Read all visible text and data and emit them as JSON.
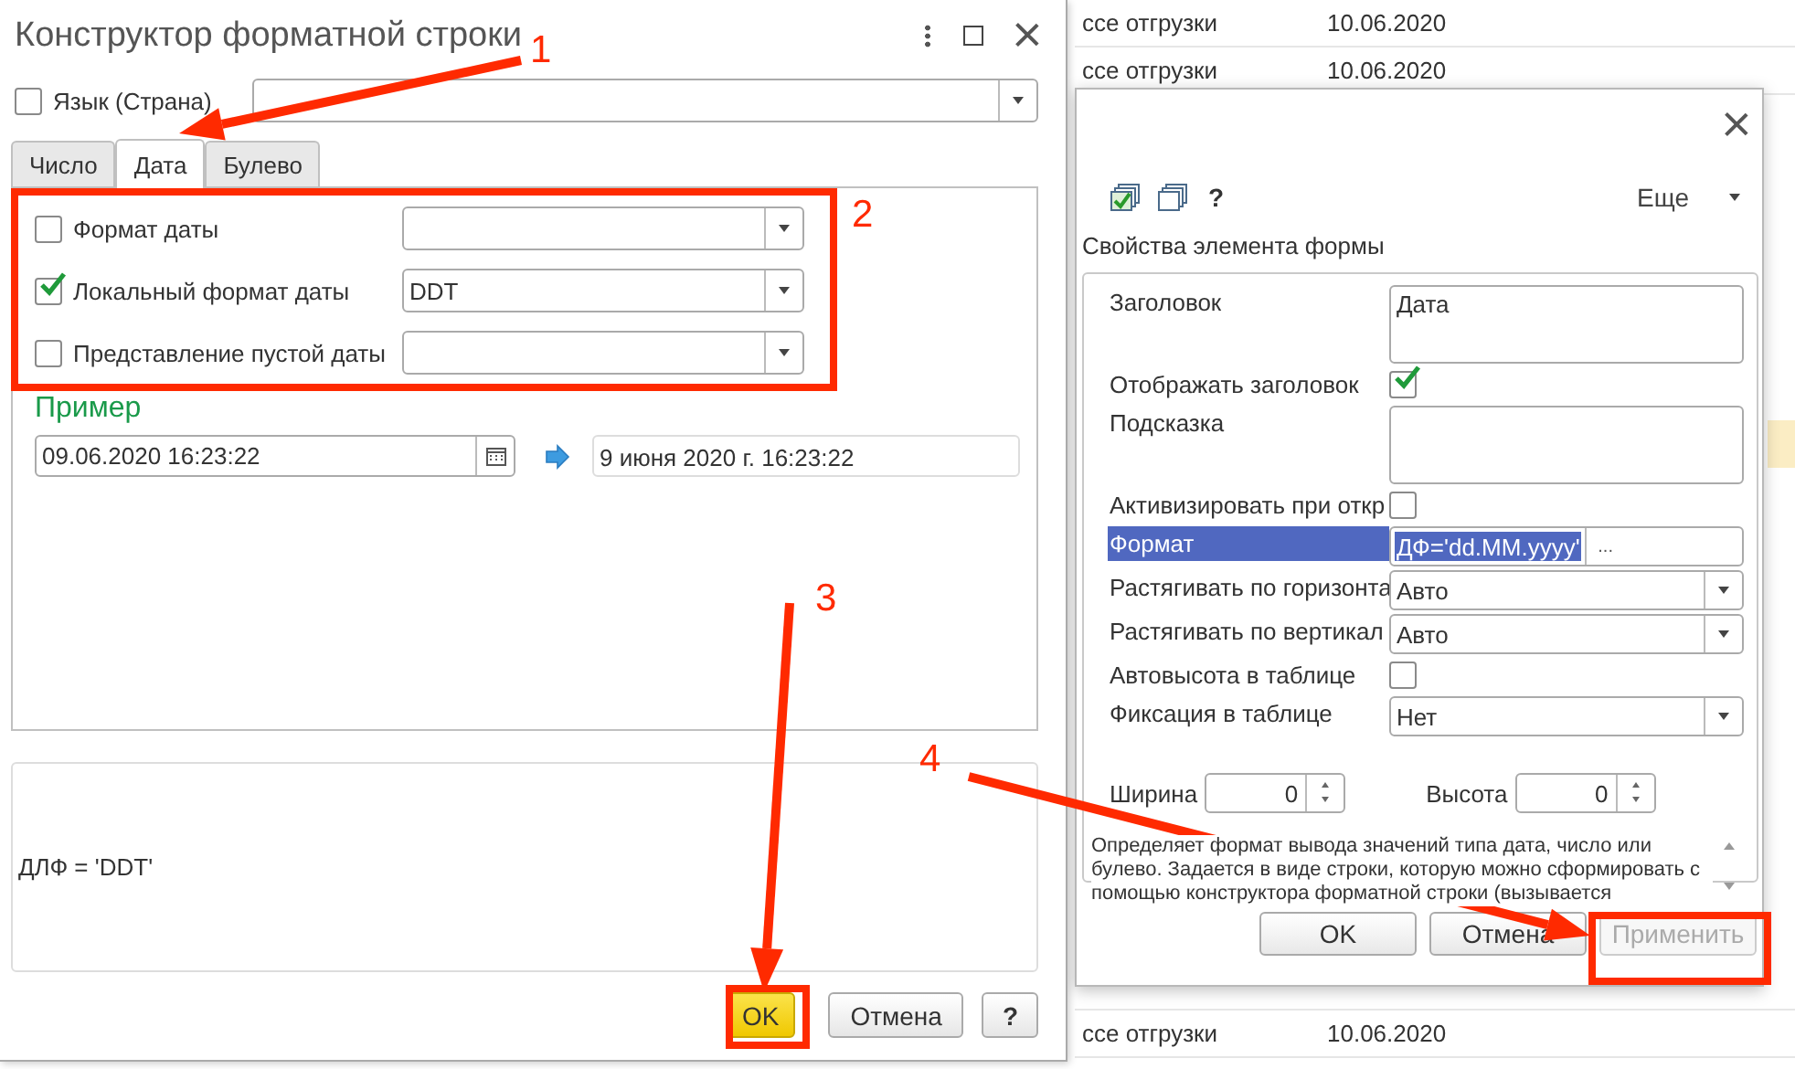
{
  "background_list": {
    "rows": [
      {
        "column_1": "ссе отгрузки",
        "column_2": "10.06.2020"
      },
      {
        "column_1": "ссе отгрузки",
        "column_2": "10.06.2020"
      },
      {
        "column_1": "ссе отгрузки",
        "column_2": "10.06.2020"
      }
    ]
  },
  "properties_window": {
    "more_label": "Еще",
    "help_label": "?",
    "section_title": "Свойства элемента формы",
    "properties": [
      {
        "kind": "textarea",
        "label": "Заголовок",
        "value": "Дата",
        "selected": false
      },
      {
        "kind": "checkbox",
        "label": "Отображать заголовок",
        "checked": true,
        "selected": false
      },
      {
        "kind": "textarea",
        "label": "Подсказка",
        "selected": false
      },
      {
        "kind": "checkbox",
        "label": "Активизировать при откр",
        "checked": false,
        "selected": false
      },
      {
        "kind": "picker",
        "label": "Формат",
        "value": "ДФ='dd.MM.yyyy'",
        "button_label": "...",
        "selected": true
      },
      {
        "kind": "dropdown",
        "label": "Растягивать по горизонта",
        "value": "Авто",
        "selected": false
      },
      {
        "kind": "dropdown",
        "label": "Растягивать по вертикал",
        "value": "Авто",
        "selected": false
      },
      {
        "kind": "checkbox",
        "label": "Автовысота в таблице",
        "checked": false,
        "selected": false
      },
      {
        "kind": "dropdown",
        "label": "Фиксация в таблице",
        "value": "Нет",
        "selected": false
      }
    ],
    "sizes": [
      {
        "label": "Ширина",
        "value": "0"
      },
      {
        "label": "Высота",
        "value": "0"
      }
    ],
    "description": "Определяет формат вывода значений типа дата, число или булево. Задается в виде строки, которую можно сформировать с помощью конструктора форматной строки (вызывается",
    "buttons": [
      {
        "label": "OK",
        "disabled": false
      },
      {
        "label": "Отмена",
        "disabled": false
      },
      {
        "label": "Применить",
        "disabled": true
      }
    ]
  },
  "format_dialog": {
    "title": "Конструктор форматной строки",
    "language": {
      "label": "Язык (Страна)",
      "checked": false
    },
    "tabs": [
      {
        "label": "Число",
        "selected": false
      },
      {
        "label": "Дата",
        "selected": true
      },
      {
        "label": "Булево",
        "selected": false
      }
    ],
    "date_options": [
      {
        "label": "Формат даты",
        "checked": false
      },
      {
        "label": "Локальный формат даты",
        "checked": true,
        "value": "DDT"
      },
      {
        "label": "Представление пустой даты",
        "checked": false
      }
    ],
    "example": {
      "title": "Пример",
      "input": "09.06.2020 16:23:22",
      "result": "9 июня 2020 г. 16:23:22"
    },
    "format_string": "ДЛФ = 'DDT'",
    "buttons": [
      {
        "label": "OK",
        "kind": "default"
      },
      {
        "label": "Отмена",
        "kind": "normal"
      },
      {
        "label": "?",
        "kind": "help"
      }
    ]
  },
  "annotations": {
    "markers": [
      "1",
      "2",
      "3",
      "4"
    ]
  }
}
